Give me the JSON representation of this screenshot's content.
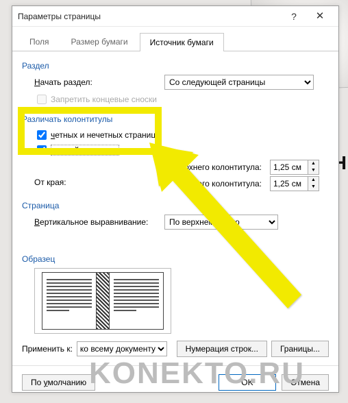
{
  "titlebar": {
    "title": "Параметры страницы",
    "help": "?",
    "close": "✕"
  },
  "tabs": {
    "t0": "Поля",
    "t1": "Размер бумаги",
    "t2": "Источник бумаги"
  },
  "section": {
    "razdel": "Раздел",
    "start_label_pre": "Н",
    "start_label_rest": "ачать раздел:",
    "start_value": "Со следующей страницы",
    "suppress_partial": "Запретить концевые сноски"
  },
  "headers": {
    "group": "Различать колонтитулы",
    "odd_even": "четных и нечетных страниц",
    "first_page": "первой страницы",
    "from_edge": "От края:",
    "top_label": "до верхнего колонтитула:",
    "bottom_label_pre": "до н",
    "bottom_label_post": "его колонтитула:",
    "top_value": "1,25 см",
    "bottom_value": "1,25 см"
  },
  "page": {
    "group": "Страница",
    "valign_pre": "В",
    "valign_rest": "ертикальное выравнивание:",
    "valign_value": "По верхнему краю"
  },
  "preview": {
    "label": "Образец"
  },
  "apply": {
    "label": "Применить к:",
    "value": "ко всему документу",
    "line_numbers": "Нумерация строк...",
    "borders": "Границы..."
  },
  "footer": {
    "default_pre": "По ",
    "default_u": "у",
    "default_post": "молчанию",
    "ok": "OK",
    "cancel": "Отмена"
  },
  "watermark": "KONEKTO.RU"
}
